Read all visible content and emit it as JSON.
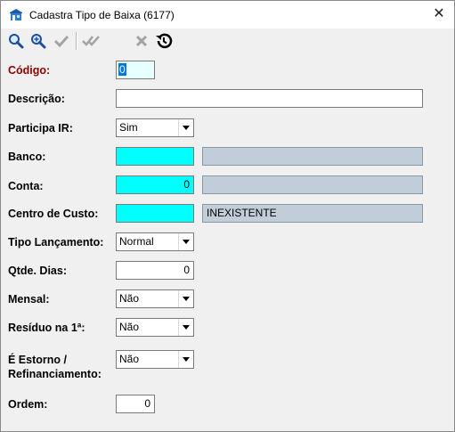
{
  "window": {
    "title": "Cadastra Tipo de Baixa (6177)",
    "close_glyph": "✕"
  },
  "toolbar": {
    "icons": [
      "search-icon",
      "search-plus-icon",
      "check-icon",
      "double-check-icon",
      "delete-x-icon",
      "history-icon"
    ]
  },
  "form": {
    "codigo": {
      "label": "Código:",
      "value": "0"
    },
    "descricao": {
      "label": "Descrição:",
      "value": ""
    },
    "participa_ir": {
      "label": "Participa IR:",
      "value": "Sim"
    },
    "banco": {
      "label": "Banco:",
      "code": "",
      "name": ""
    },
    "conta": {
      "label": "Conta:",
      "code": "0",
      "name": ""
    },
    "centro_custo": {
      "label": "Centro de Custo:",
      "code": "",
      "name": "INEXISTENTE"
    },
    "tipo_lancamento": {
      "label": "Tipo Lançamento:",
      "value": "Normal"
    },
    "qtde_dias": {
      "label": "Qtde. Dias:",
      "value": "0"
    },
    "mensal": {
      "label": "Mensal:",
      "value": "Não"
    },
    "residuo": {
      "label": "Resíduo na 1ª:",
      "value": "Não"
    },
    "estorno": {
      "label_line1": "É Estorno /",
      "label_line2": "Refinanciamento:",
      "value": "Não"
    },
    "ordem": {
      "label": "Ordem:",
      "value": "0"
    }
  },
  "colors": {
    "required_label": "#8b0000",
    "lookup_field": "#00ffff",
    "readonly_field": "#c1cdd8"
  }
}
